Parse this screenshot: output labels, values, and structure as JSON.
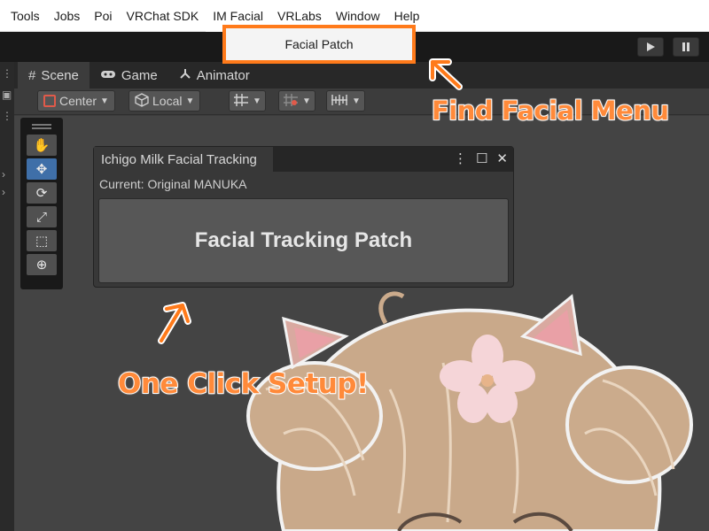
{
  "menubar": {
    "items": [
      "Tools",
      "Jobs",
      "Poi",
      "VRChat SDK",
      "IM Facial",
      "VRLabs",
      "Window",
      "Help"
    ]
  },
  "dropdown": {
    "item": "Facial Patch"
  },
  "tabs": {
    "scene": "Scene",
    "game": "Game",
    "animator": "Animator"
  },
  "scene_toolbar": {
    "pivot": "Center",
    "space": "Local"
  },
  "floating_window": {
    "title": "Ichigo Milk Facial Tracking",
    "current": "Current: Original MANUKA",
    "button": "Facial Tracking Patch"
  },
  "annotations": {
    "find_menu": "Find Facial Menu",
    "one_click": "One Click Setup!"
  },
  "colors": {
    "accent": "#ff7a1a",
    "annotation": "#ff8a3a",
    "active_tool": "#3f6fa8"
  },
  "icons": [
    "hand-icon",
    "move-icon",
    "rotate-icon",
    "scale-icon",
    "rect-icon",
    "transform-icon",
    "play-icon",
    "pause-icon"
  ]
}
